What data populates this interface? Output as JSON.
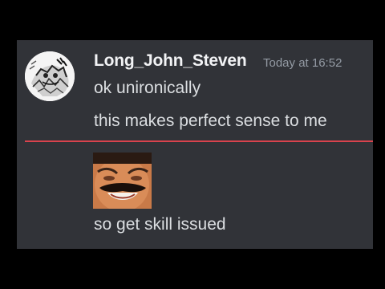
{
  "message_group": {
    "author": "Long_John_Steven",
    "timestamp": "Today at 16:52",
    "messages": [
      "ok unironically",
      "this makes perfect sense to me",
      "so get skill issued"
    ],
    "divider_color": "#d9434d",
    "avatar_icon": "manga-drawing-avatar",
    "emote_icon": "laughing-man-emoji"
  },
  "colors": {
    "panel_background": "#313338",
    "username": "#f2f3f5",
    "message_text": "#dbdee1",
    "timestamp": "#949ba4"
  }
}
